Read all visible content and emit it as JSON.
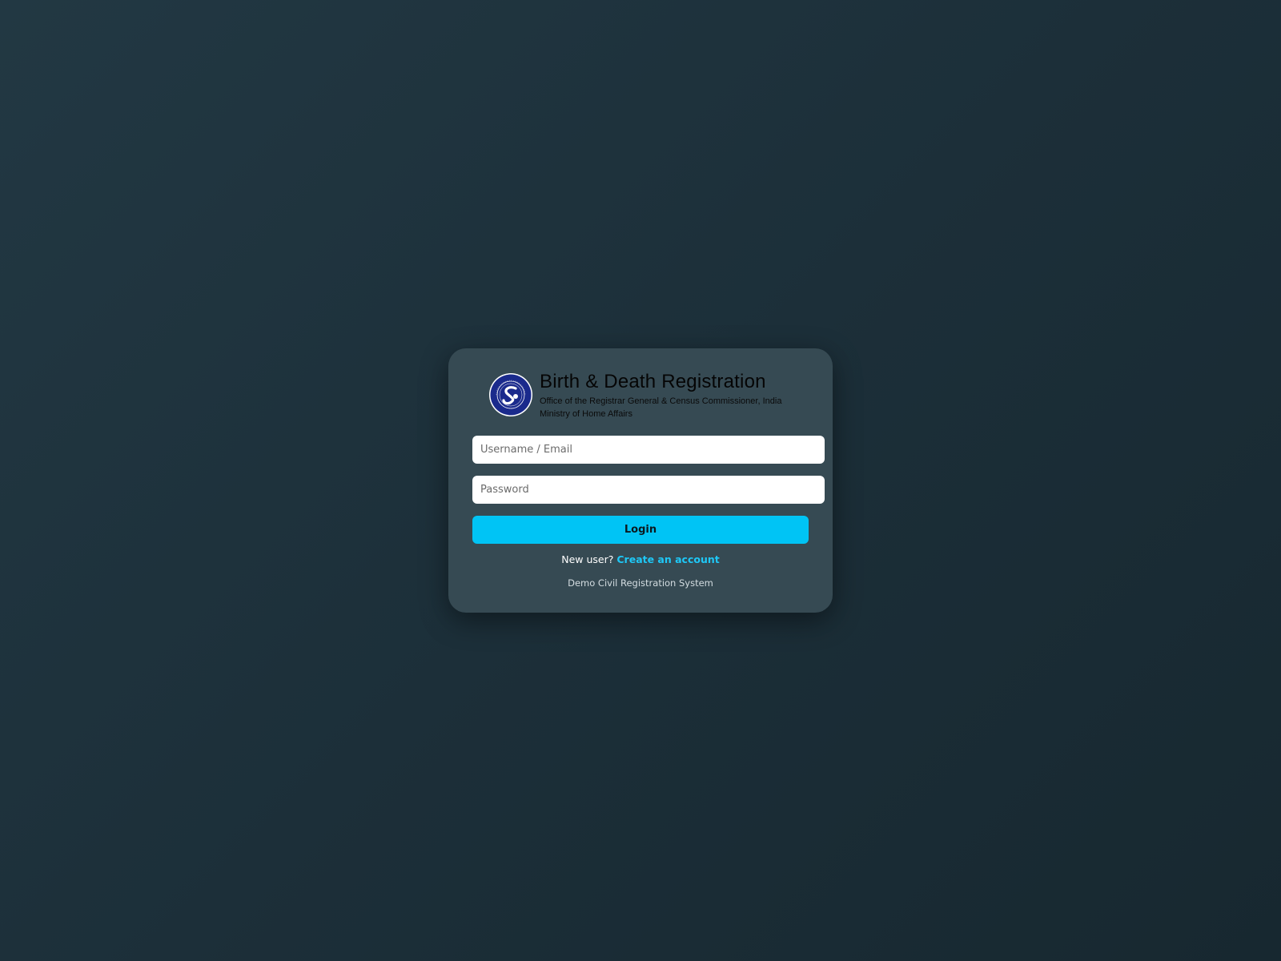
{
  "brand": {
    "title": "Birth & Death Registration",
    "subtitle_line1": "Office of the Registrar General & Census Commissioner, India",
    "subtitle_line2": "Ministry of Home Affairs",
    "logo_icon": "registrar-general-emblem-icon"
  },
  "form": {
    "username_placeholder": "Username / Email",
    "password_placeholder": "Password",
    "login_label": "Login"
  },
  "signup": {
    "prompt": "New user?",
    "link_label": "Create an account"
  },
  "footer": {
    "note": "Demo Civil Registration System"
  },
  "colors": {
    "background": "#1e323c",
    "card": "#364a53",
    "accent": "#00c4f5",
    "emblem": "#1a2a8c"
  }
}
